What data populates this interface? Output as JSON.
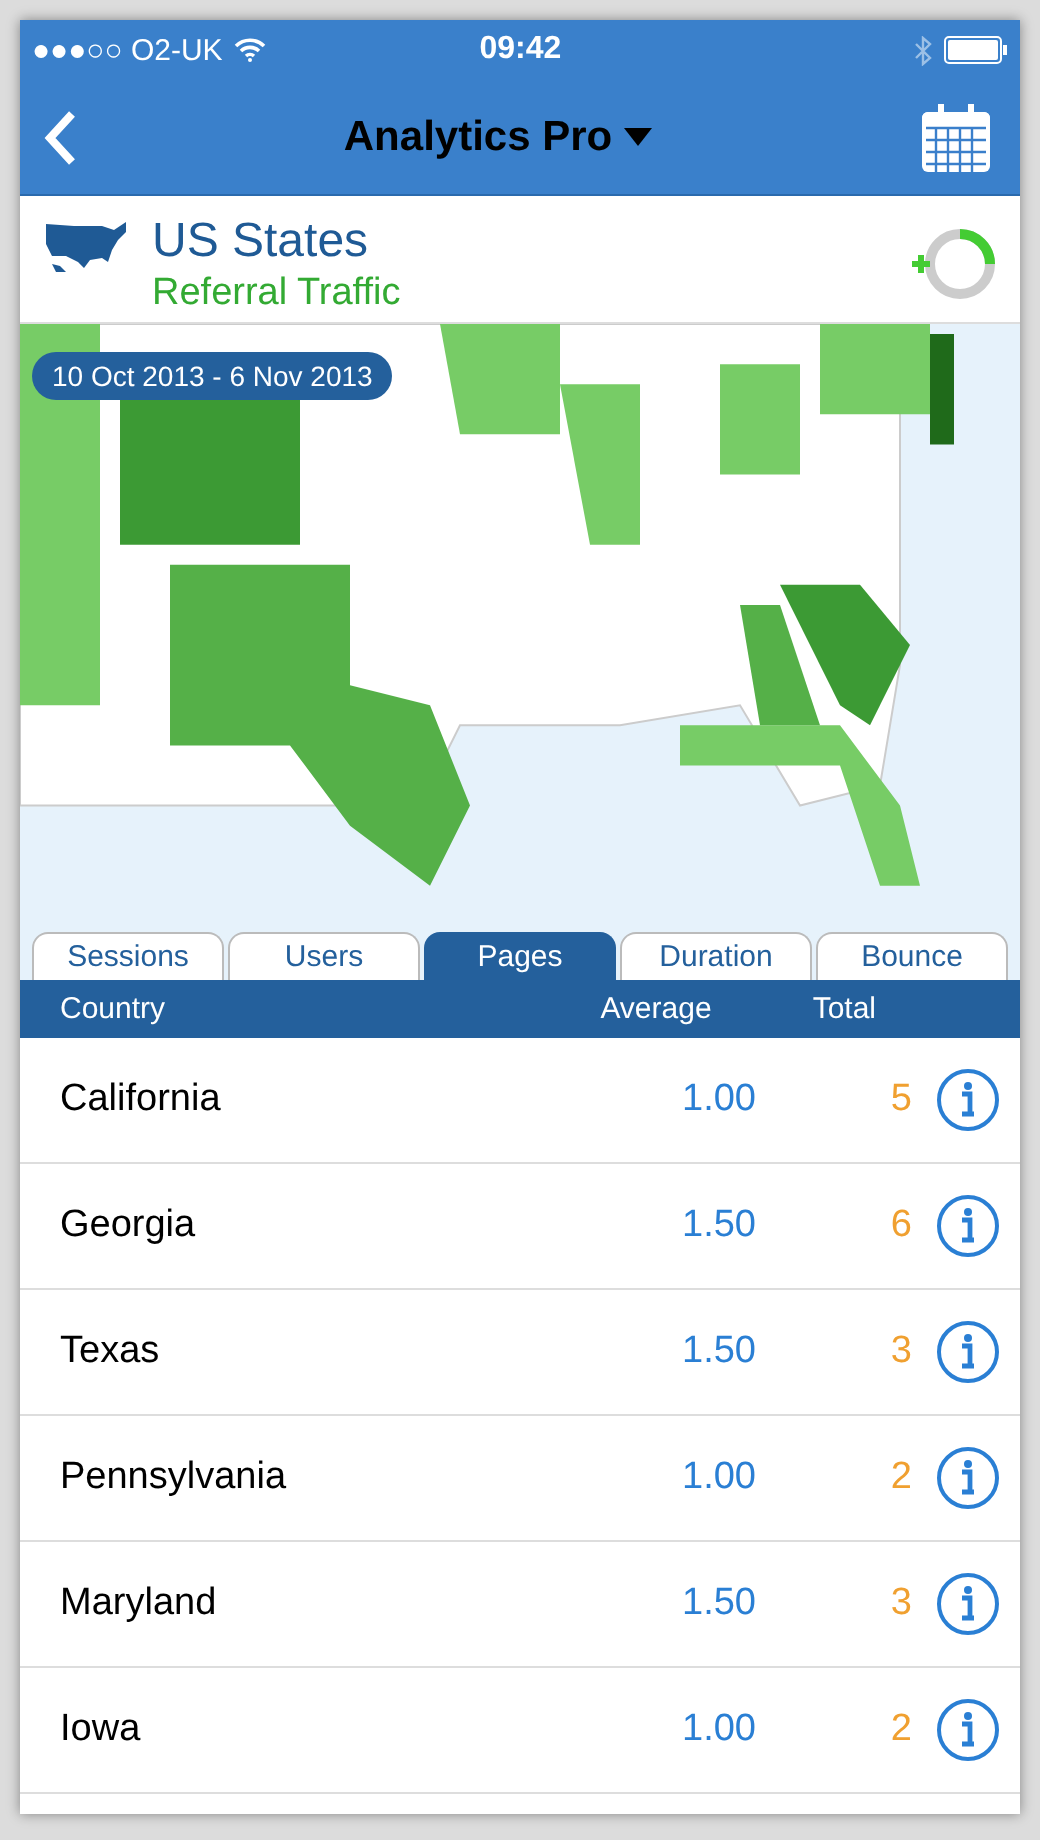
{
  "status_bar": {
    "carrier": "●●●○○ O2-UK",
    "time": "09:42"
  },
  "nav": {
    "title": "Analytics Pro"
  },
  "header": {
    "title": "US States",
    "subtitle": "Referral Traffic"
  },
  "map": {
    "kind": "picture",
    "date_range": "10 Oct 2013 - 6 Nov 2013"
  },
  "tabs": [
    {
      "label": "Sessions",
      "selected": false
    },
    {
      "label": "Users",
      "selected": false
    },
    {
      "label": "Pages",
      "selected": true
    },
    {
      "label": "Duration",
      "selected": false
    },
    {
      "label": "Bounce",
      "selected": false
    }
  ],
  "table": {
    "columns": [
      "Country",
      "Average",
      "Total"
    ],
    "rows": [
      {
        "name": "California",
        "average": "1.00",
        "total": "5"
      },
      {
        "name": "Georgia",
        "average": "1.50",
        "total": "6"
      },
      {
        "name": "Texas",
        "average": "1.50",
        "total": "3"
      },
      {
        "name": "Pennsylvania",
        "average": "1.00",
        "total": "2"
      },
      {
        "name": "Maryland",
        "average": "1.50",
        "total": "3"
      },
      {
        "name": "Iowa",
        "average": "1.00",
        "total": "2"
      }
    ]
  }
}
